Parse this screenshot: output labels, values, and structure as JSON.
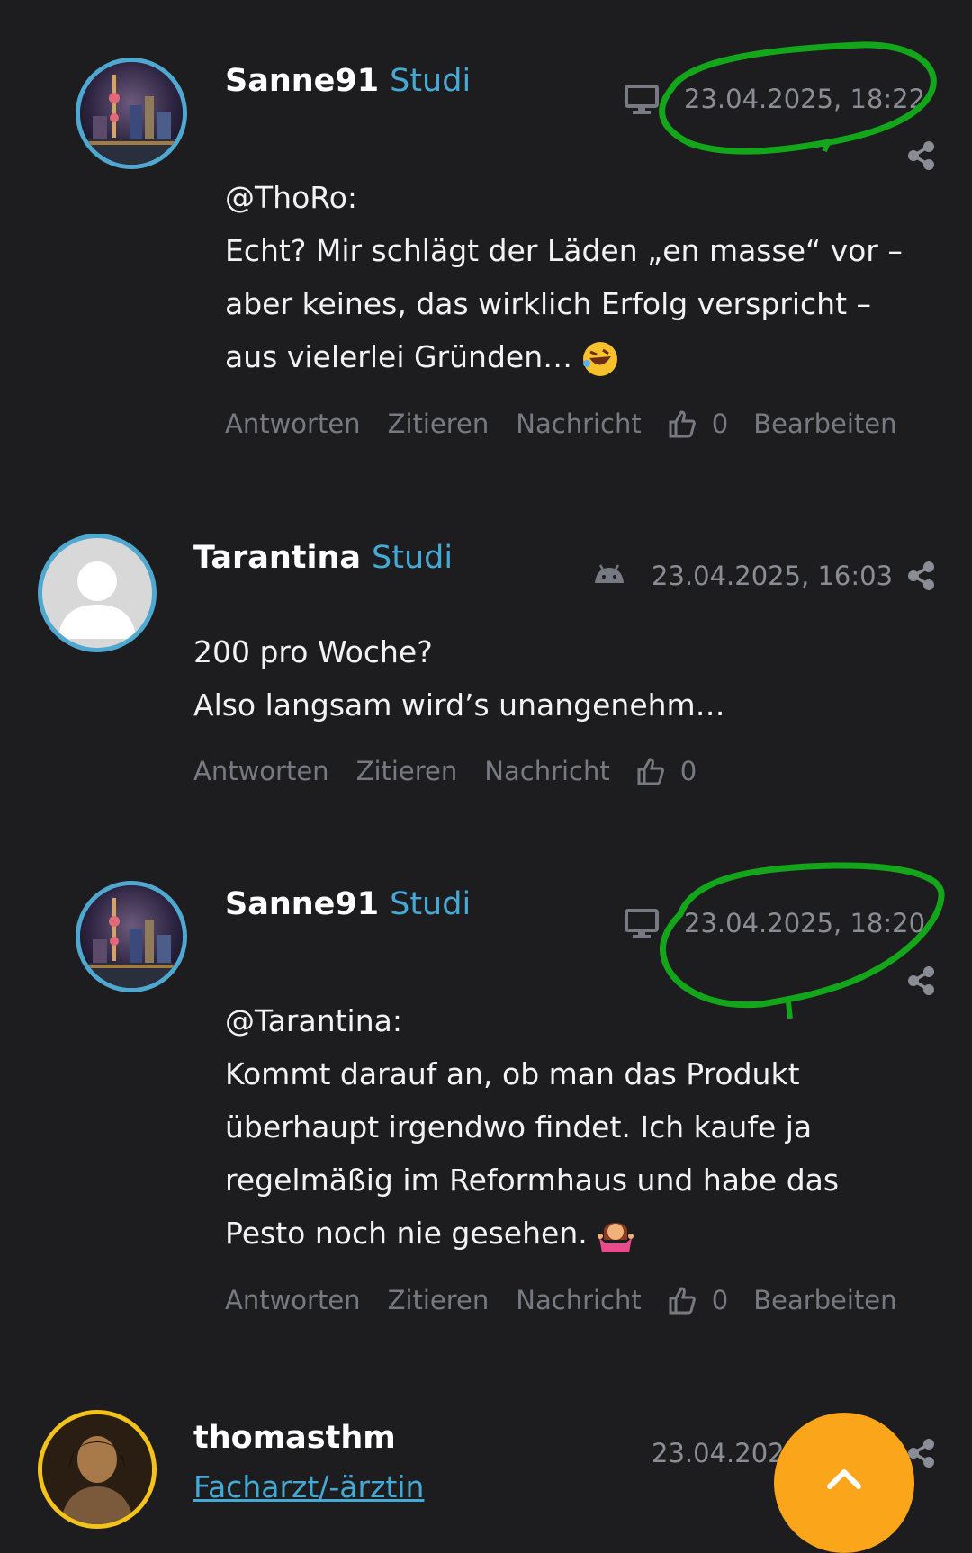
{
  "posts": [
    {
      "username": "Sanne91",
      "role": "Studi",
      "device": "desktop-icon",
      "date": "23.04.2025, 18:22",
      "lines": [
        "@ThoRo:",
        "Echt? Mir schlägt der Läden „en masse“ vor –",
        "aber keines, das wirklich Erfolg verspricht –",
        "aus vielerlei Gründen…"
      ],
      "emoji": "rofl-emoji",
      "actions": {
        "reply": "Antworten",
        "quote": "Zitieren",
        "message": "Nachricht",
        "likes": "0",
        "edit": "Bearbeiten"
      }
    },
    {
      "username": "Tarantina",
      "role": "Studi",
      "device": "android-icon",
      "date": "23.04.2025, 16:03",
      "lines": [
        "200 pro Woche?",
        "Also langsam wird’s unangenehm…"
      ],
      "actions": {
        "reply": "Antworten",
        "quote": "Zitieren",
        "message": "Nachricht",
        "likes": "0"
      }
    },
    {
      "username": "Sanne91",
      "role": "Studi",
      "device": "desktop-icon",
      "date": "23.04.2025, 18:20",
      "lines": [
        "@Tarantina:",
        "Kommt darauf an, ob man das Produkt",
        "überhaupt irgendwo findet. Ich kaufe ja",
        "regelmäßig im Reformhaus und habe das",
        "Pesto noch nie gesehen."
      ],
      "emoji": "shrug-emoji",
      "actions": {
        "reply": "Antworten",
        "quote": "Zitieren",
        "message": "Nachricht",
        "likes": "0",
        "edit": "Bearbeiten"
      }
    },
    {
      "username": "thomasthm",
      "role": "Facharzt/-ärztin",
      "date": "23.04.202"
    }
  ],
  "colors": {
    "background": "#1d1d1f",
    "role": "#45a9d5",
    "avatar_ring": "#4fa8cf",
    "avatar_ring_gold": "#f3c21b",
    "highlight_circle": "#13a51a",
    "fab": "#fba51a"
  },
  "fab": {
    "icon": "chevron-up-icon"
  }
}
